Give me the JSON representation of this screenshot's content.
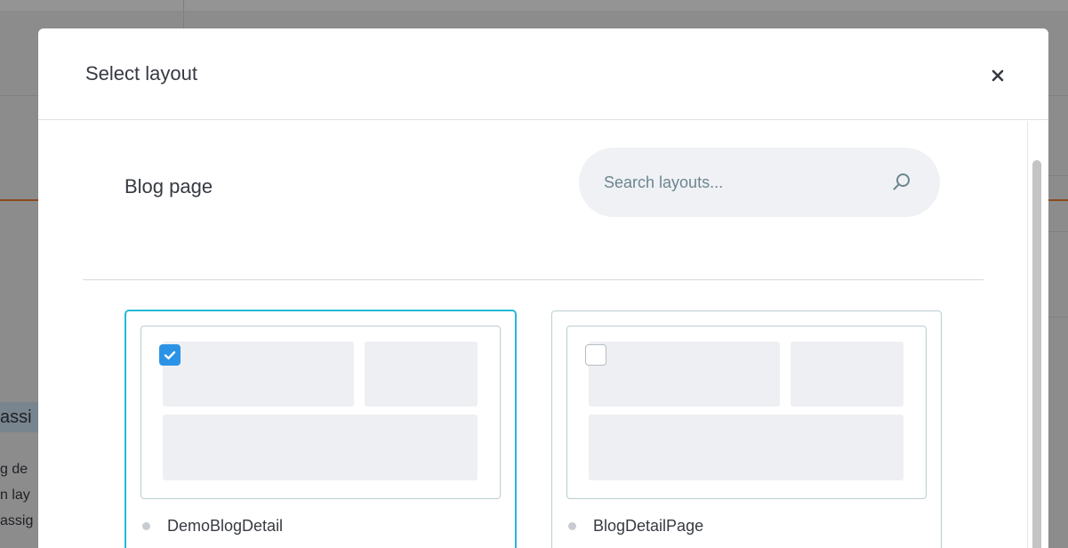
{
  "background": {
    "heading_fragment": "assi",
    "text_lines": [
      "g de",
      "n lay",
      "assig"
    ]
  },
  "modal": {
    "title": "Select layout",
    "close_icon": "close-icon",
    "section_title": "Blog page",
    "search": {
      "placeholder": "Search layouts...",
      "value": "",
      "icon": "search-icon"
    },
    "layouts": [
      {
        "name": "DemoBlogDetail",
        "selected": true
      },
      {
        "name": "BlogDetailPage",
        "selected": false
      }
    ]
  },
  "colors": {
    "accent_border": "#25b9d7",
    "checkbox_checked": "#2b93e6",
    "background_orange_rule": "#f07d35",
    "text": "#363a41"
  }
}
